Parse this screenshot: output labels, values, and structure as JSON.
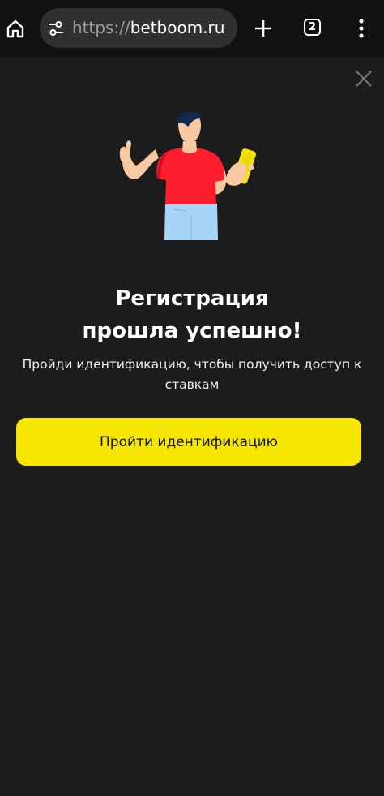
{
  "browser": {
    "url_scheme": "https://",
    "url_host": "betboom.ru",
    "tab_count": "2"
  },
  "modal": {
    "title_line1": "Регистрация",
    "title_line2": "прошла успешно!",
    "subtitle": "Пройди идентификацию, чтобы получить доступ к ставкам",
    "cta_label": "Пройти идентификацию"
  },
  "colors": {
    "background": "#1c1c1c",
    "browser_bar": "#111111",
    "cta": "#f6e600",
    "shirt": "#ff1e2d",
    "phone": "#f6e600"
  },
  "icons": [
    "home-icon",
    "site-settings-icon",
    "plus-icon",
    "tab-switcher-icon",
    "more-vert-icon",
    "close-icon"
  ]
}
